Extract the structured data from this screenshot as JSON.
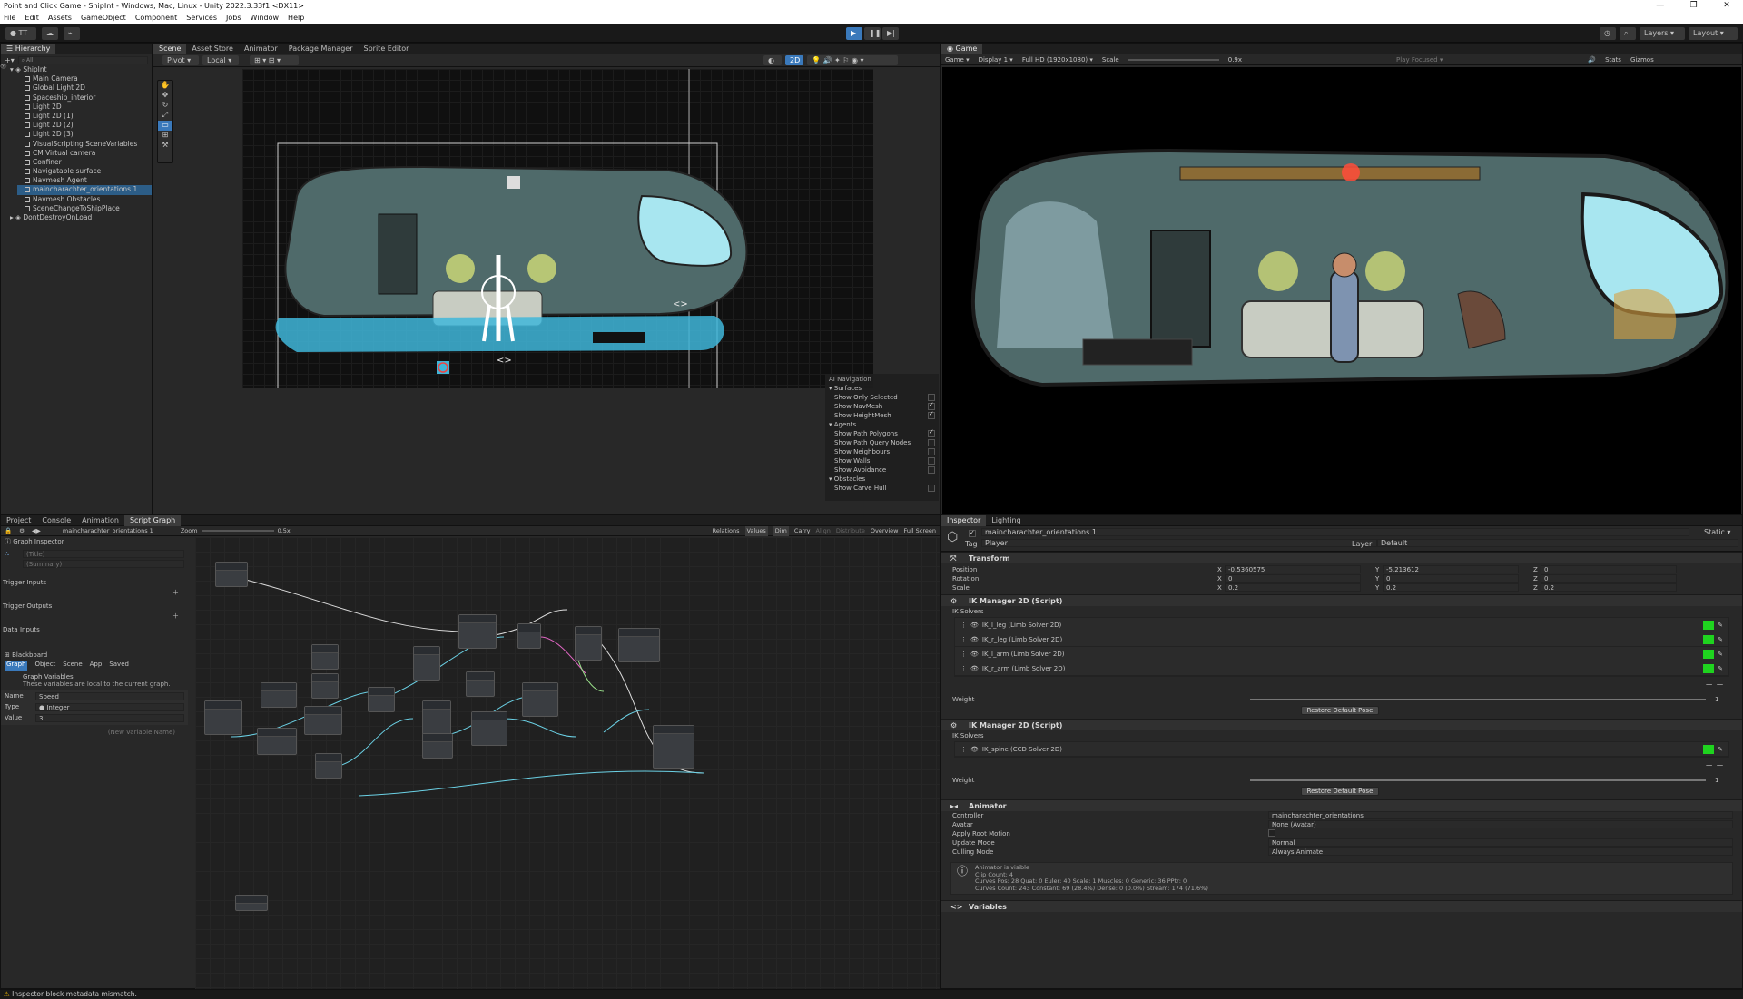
{
  "window": {
    "title": "Point and Click Game - ShipInt - Windows, Mac, Linux - Unity 2022.3.33f1 <DX11>"
  },
  "menu": [
    "File",
    "Edit",
    "Assets",
    "GameObject",
    "Component",
    "Services",
    "Jobs",
    "Window",
    "Help"
  ],
  "toolbar": {
    "account": "TT",
    "layers": "Layers",
    "layout": "Layout"
  },
  "hierarchy": {
    "tab": "Hierarchy",
    "search_placeholder": "All",
    "scene": "ShipInt",
    "items": [
      "Main Camera",
      "Global Light 2D",
      "Spaceship_interior",
      "Light 2D",
      "Light 2D (1)",
      "Light 2D (2)",
      "Light 2D (3)",
      "VisualScripting SceneVariables",
      "CM Virtual camera",
      "Confiner",
      "Navigatable surface",
      "Navmesh Agent",
      "maincharachter_orientations 1",
      "Navmesh Obstacles",
      "SceneChangeToShipPlace"
    ],
    "dont_destroy": "DontDestroyOnLoad"
  },
  "scene_tabs": [
    "Scene",
    "Asset Store",
    "Animator",
    "Package Manager",
    "Sprite Editor"
  ],
  "scene_toolbar": {
    "pivot": "Pivot",
    "local": "Local",
    "mode2d": "2D"
  },
  "ai_nav": {
    "title": "AI Navigation",
    "surfaces": "Surfaces",
    "surface_items": [
      {
        "label": "Show Only Selected",
        "on": false
      },
      {
        "label": "Show NavMesh",
        "on": true
      },
      {
        "label": "Show HeightMesh",
        "on": true
      }
    ],
    "agents": "Agents",
    "agent_items": [
      {
        "label": "Show Path Polygons",
        "on": true
      },
      {
        "label": "Show Path Query Nodes",
        "on": false
      },
      {
        "label": "Show Neighbours",
        "on": false
      },
      {
        "label": "Show Walls",
        "on": false
      },
      {
        "label": "Show Avoidance",
        "on": false
      }
    ],
    "obstacles": "Obstacles",
    "obstacle_items": [
      {
        "label": "Show Carve Hull",
        "on": false
      }
    ]
  },
  "game": {
    "tab": "Game",
    "mode": "Game",
    "display": "Display 1",
    "resolution": "Full HD (1920x1080)",
    "scale_label": "Scale",
    "scale_value": "0.9x",
    "play_focused": "Play Focused",
    "stats": "Stats",
    "gizmos": "Gizmos"
  },
  "bottom_tabs": [
    "Project",
    "Console",
    "Animation",
    "Script Graph"
  ],
  "script_graph": {
    "breadcrumb": "maincharachter_orientations 1",
    "zoom_label": "Zoom",
    "zoom_value": "0.5x",
    "toolbar": [
      "Relations",
      "Values",
      "Dim",
      "Carry",
      "Align",
      "Distribute",
      "Overview",
      "Full Screen"
    ]
  },
  "graph_inspector": {
    "title": "Graph Inspector",
    "title_placeholder": "(Title)",
    "summary_placeholder": "(Summary)",
    "trigger_inputs": "Trigger Inputs",
    "trigger_outputs": "Trigger Outputs",
    "data_inputs": "Data Inputs"
  },
  "blackboard": {
    "title": "Blackboard",
    "tabs": [
      "Graph",
      "Object",
      "Scene",
      "App",
      "Saved"
    ],
    "heading": "Graph Variables",
    "desc": "These variables are local to the current graph.",
    "name_label": "Name",
    "name_value": "Speed",
    "type_label": "Type",
    "type_value": "Integer",
    "value_label": "Value",
    "value_value": "3",
    "new_placeholder": "(New Variable Name)"
  },
  "inspector": {
    "tabs": [
      "Inspector",
      "Lighting"
    ],
    "object_name": "maincharachter_orientations 1",
    "static": "Static",
    "tag_label": "Tag",
    "tag_value": "Player",
    "layer_label": "Layer",
    "layer_value": "Default",
    "transform": {
      "title": "Transform",
      "rows": [
        {
          "label": "Position",
          "x": "-0.5360575",
          "y": "-5.213612",
          "z": "0"
        },
        {
          "label": "Rotation",
          "x": "0",
          "y": "0",
          "z": "0"
        },
        {
          "label": "Scale",
          "x": "0.2",
          "y": "0.2",
          "z": "0.2"
        }
      ]
    },
    "ik1": {
      "title": "IK Manager 2D (Script)",
      "solvers_label": "IK Solvers",
      "solvers": [
        "IK_l_leg (Limb Solver 2D)",
        "IK_r_leg (Limb Solver 2D)",
        "IK_l_arm (Limb Solver 2D)",
        "IK_r_arm (Limb Solver 2D)"
      ],
      "weight_label": "Weight",
      "weight_value": "1",
      "restore": "Restore Default Pose"
    },
    "ik2": {
      "title": "IK Manager 2D (Script)",
      "solvers_label": "IK Solvers",
      "solvers": [
        "IK_spine (CCD Solver 2D)"
      ],
      "weight_label": "Weight",
      "weight_value": "1",
      "restore": "Restore Default Pose"
    },
    "animator": {
      "title": "Animator",
      "rows": [
        {
          "label": "Controller",
          "value": "maincharachter_orientations"
        },
        {
          "label": "Avatar",
          "value": "None (Avatar)"
        },
        {
          "label": "Apply Root Motion",
          "value": ""
        },
        {
          "label": "Update Mode",
          "value": "Normal"
        },
        {
          "label": "Culling Mode",
          "value": "Always Animate"
        }
      ],
      "info": [
        "Animator is visible",
        "Clip Count: 4",
        "Curves Pos: 28 Quat: 0 Euler: 40 Scale: 1 Muscles: 0 Generic: 36 PPtr: 0",
        "Curves Count: 243 Constant: 69 (28.4%) Dense: 0 (0.0%) Stream: 174 (71.6%)"
      ]
    },
    "variables": "Variables"
  },
  "status": {
    "message": "Inspector block metadata mismatch."
  },
  "colors": {
    "accent": "#3a79bb",
    "solver_green": "#1fd31f",
    "navmesh": "#3fb6d9"
  }
}
